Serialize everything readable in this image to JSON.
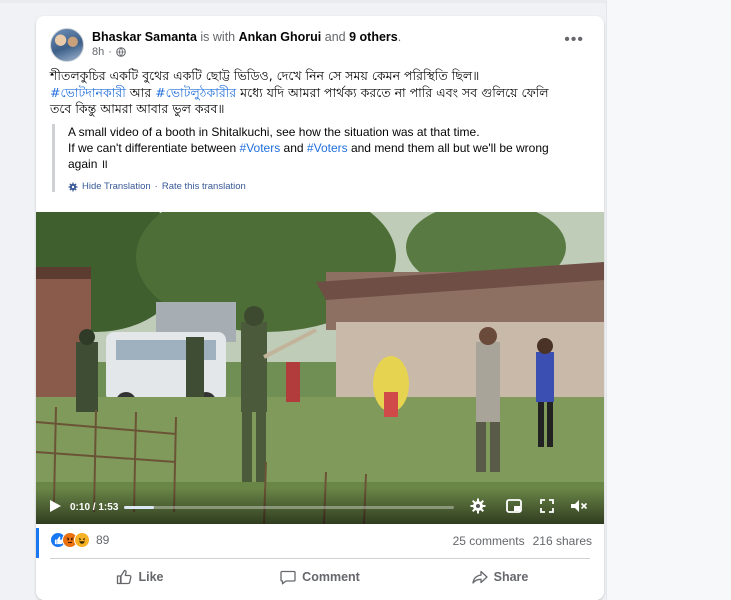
{
  "post": {
    "author": "Bhaskar Samanta",
    "with_text": "is with",
    "tagged_person": "Ankan Ghorui",
    "and_text": "and",
    "others": "9 others",
    "period": ".",
    "time": "8h",
    "privacy_sep": "·",
    "text_line1": "শীতলকুচির একটি বুথের  একটি ছোট্ট ভিডিও, দেখে নিন সে সময় কেমন পরিস্থিতি ছিল॥",
    "hashtag1": "#ভোটদানকারী",
    "text_mid": " আর ",
    "hashtag2": "#ভোটলুঠকারীর",
    "text_line2_end": " মধ্যে যদি আমরা পার্থক্য করতে না পারি এবং  সব গুলিয়ে ফেলি",
    "text_line3": "তবে কিন্তু আমরা আবার ভুল করব॥"
  },
  "translation": {
    "line1": "A small video of a booth in Shitalkuchi, see how the situation was at that time.",
    "line2_a": "If we can't differentiate between ",
    "hashtag_a": "#Voters",
    "line2_b": " and ",
    "hashtag_b": "#Voters",
    "line2_c": " and mend them all but we'll be wrong",
    "line3": "again ॥",
    "hide_link": "Hide Translation",
    "link_sep": " · ",
    "rate_link": "Rate this translation"
  },
  "video": {
    "current_time": "0:10",
    "separator": " / ",
    "duration": "1:53",
    "progress": 0.09
  },
  "stats": {
    "reaction_count": "89",
    "comments": "25 comments",
    "shares": "216 shares"
  },
  "actions": {
    "like": "Like",
    "comment": "Comment",
    "share": "Share"
  },
  "colors": {
    "link": "#216fdb",
    "accent": "#1877f2",
    "muted": "#65676b"
  }
}
